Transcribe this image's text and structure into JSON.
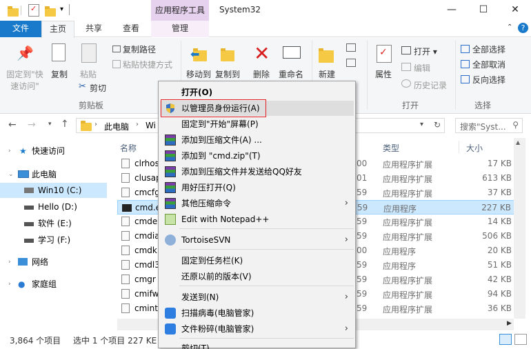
{
  "title_bar": {
    "context_tab": "应用程序工具",
    "window_title": "System32",
    "min_glyph": "—",
    "max_glyph": "☐",
    "close_glyph": "✕"
  },
  "tabs": {
    "file": "文件",
    "home": "主页",
    "share": "共享",
    "view": "查看",
    "manage": "管理"
  },
  "ribbon": {
    "pin_quick_1": "固定到\"快",
    "pin_quick_2": "速访问\"",
    "copy": "复制",
    "paste": "粘贴",
    "copy_path": "复制路径",
    "paste_shortcut": "粘贴快捷方式",
    "cut": "剪切",
    "clipboard_group": "剪贴板",
    "move_to": "移动到",
    "copy_to": "复制到",
    "delete": "删除",
    "rename": "重命名",
    "new": "新建",
    "properties": "属性",
    "open": "打开",
    "edit": "编辑",
    "history": "历史记录",
    "open_group": "打开",
    "select_all": "全部选择",
    "select_none": "全部取消",
    "invert": "反向选择",
    "select_group": "选择"
  },
  "address": {
    "path_root": "此电脑",
    "path_next": "Wi",
    "search_placeholder": "搜索\"Syst..."
  },
  "nav": {
    "quick_access": "快速访问",
    "this_pc": "此电脑",
    "drive_c": "Win10 (C:)",
    "drive_d": "Hello (D:)",
    "drive_e": "软件 (E:)",
    "drive_f": "学习 (F:)",
    "network": "网络",
    "homegroup": "家庭组"
  },
  "columns": {
    "name": "名称",
    "type": "类型",
    "size": "大小"
  },
  "files": [
    {
      "name": "clrhos",
      "date": "00",
      "type": "应用程序扩展",
      "size": "17 KB"
    },
    {
      "name": "clusap",
      "date": "01",
      "type": "应用程序扩展",
      "size": "613 KB"
    },
    {
      "name": "cmcfg",
      "date": "59",
      "type": "应用程序扩展",
      "size": "37 KB"
    },
    {
      "name": "cmd.e",
      "date": "59",
      "type": "应用程序",
      "size": "227 KB"
    },
    {
      "name": "cmde",
      "date": "59",
      "type": "应用程序扩展",
      "size": "14 KB"
    },
    {
      "name": "cmdia",
      "date": "59",
      "type": "应用程序扩展",
      "size": "506 KB"
    },
    {
      "name": "cmdk",
      "date": "00",
      "type": "应用程序",
      "size": "20 KB"
    },
    {
      "name": "cmdl3",
      "date": "59",
      "type": "应用程序",
      "size": "51 KB"
    },
    {
      "name": "cmgr",
      "date": "59",
      "type": "应用程序扩展",
      "size": "42 KB"
    },
    {
      "name": "cmifw",
      "date": "59",
      "type": "应用程序扩展",
      "size": "94 KB"
    },
    {
      "name": "cminte",
      "date": "59",
      "type": "应用程序扩展",
      "size": "36 KB"
    }
  ],
  "status": {
    "count": "3,864 个项目",
    "selection": "选中 1 个项目  227 KE"
  },
  "context_menu": {
    "open": "打开(O)",
    "run_as_admin": "以管理员身份运行(A)",
    "pin_start": "固定到\"开始\"屏幕(P)",
    "add_archive": "添加到压缩文件(A) ...",
    "add_cmd_zip": "添加到 \"cmd.zip\"(T)",
    "add_and_qq": "添加到压缩文件并发送给QQ好友",
    "open_haozip": "用好压打开(Q)",
    "other_compress": "其他压缩命令",
    "notepadpp": "Edit with Notepad++",
    "tortoise": "TortoiseSVN",
    "pin_taskbar": "固定到任务栏(K)",
    "restore_prev": "还原以前的版本(V)",
    "send_to": "发送到(N)",
    "scan_virus": "扫描病毒(电脑管家)",
    "shred": "文件粉碎(电脑管家)",
    "cut_partial": "剪切(T)"
  },
  "colors": {
    "accent": "#1979ca",
    "selection": "#cce8ff",
    "highlight_box": "#e02020"
  }
}
